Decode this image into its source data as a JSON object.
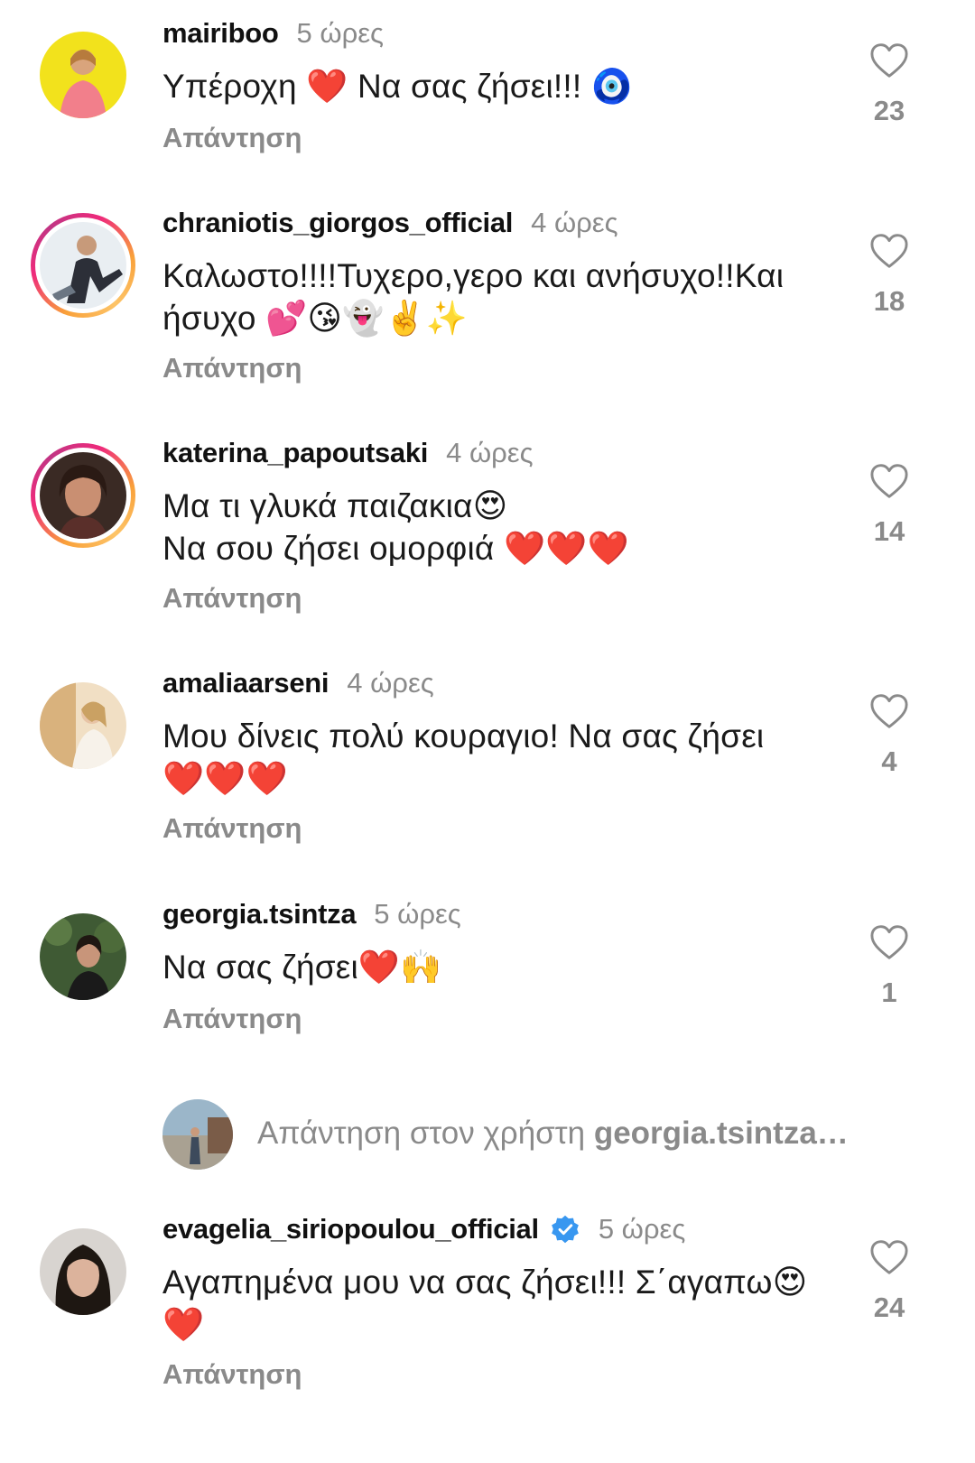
{
  "comments": [
    {
      "username": "mairiboo",
      "time": "5 ώρες",
      "line1": "Υπέροχη ❤️ Να σας ζήσει!!! 🧿",
      "line2": "",
      "reply": "Απάντηση",
      "likes": "23"
    },
    {
      "username": "chraniotis_giorgos_official",
      "time": "4 ώρες",
      "line1": "Καλωστο!!!!Τυχερο,γερο και ανήσυχο!!Και",
      "line2": "ήσυχο 💕😘👻✌️✨",
      "reply": "Απάντηση",
      "likes": "18"
    },
    {
      "username": "katerina_papoutsaki",
      "time": "4 ώρες",
      "line1": "Μα τι γλυκά παιζακια😍",
      "line2": "Να σου ζήσει ομορφιά ❤️❤️❤️",
      "reply": "Απάντηση",
      "likes": "14"
    },
    {
      "username": "amaliaarseni",
      "time": "4 ώρες",
      "line1": "Μου δίνεις πολύ κουραγιο! Να σας ζήσει",
      "line2": "❤️❤️❤️",
      "reply": "Απάντηση",
      "likes": "4"
    },
    {
      "username": "georgia.tsintza",
      "time": "5 ώρες",
      "line1": "Να σας ζήσει❤️🙌",
      "line2": "",
      "reply": "Απάντηση",
      "likes": "1"
    },
    {
      "username": "evagelia_siriopoulou_official",
      "time": "5 ώρες",
      "line1": "Αγαπημένα μου να σας ζήσει!!! Σ΄αγαπω😍",
      "line2": "❤️",
      "reply": "Απάντηση",
      "likes": "24"
    }
  ],
  "reply_bar": {
    "prefix": "Απάντηση στον χρήστη ",
    "target": "georgia.tsintza…"
  },
  "icons": {
    "like": "heart-outline-icon",
    "verified": "verified-badge-icon"
  },
  "colors": {
    "muted": "#8a8a8a",
    "verified": "#3897f0",
    "story_ring": "#ee2a7b"
  }
}
